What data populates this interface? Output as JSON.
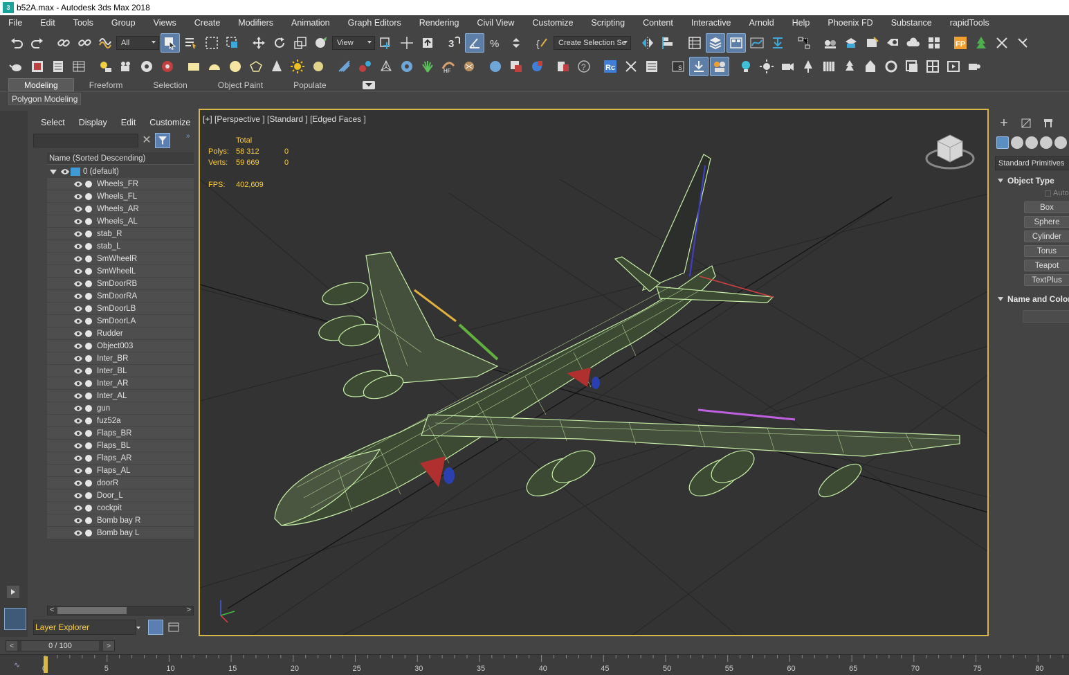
{
  "window": {
    "title": "b52A.max - Autodesk 3ds Max 2018"
  },
  "menu": [
    "File",
    "Edit",
    "Tools",
    "Group",
    "Views",
    "Create",
    "Modifiers",
    "Animation",
    "Graph Editors",
    "Rendering",
    "Civil View",
    "Customize",
    "Scripting",
    "Content",
    "Interactive",
    "Arnold",
    "Help",
    "Phoenix FD",
    "Substance",
    "rapidTools"
  ],
  "toolbar": {
    "filter_value": "All",
    "refcoord_value": "View",
    "selection_set_value": "Create Selection Se"
  },
  "ribbon": {
    "tabs": [
      "Modeling",
      "Freeform",
      "Selection",
      "Object Paint",
      "Populate"
    ],
    "active_tab": "Modeling",
    "sub_panel": "Polygon Modeling"
  },
  "explorer": {
    "menu": [
      "Select",
      "Display",
      "Edit",
      "Customize"
    ],
    "search_placeholder": "",
    "column_header": "Name (Sorted Descending)",
    "layer_name": "0 (default)",
    "objects": [
      "Wheels_FR",
      "Wheels_FL",
      "Wheels_AR",
      "Wheels_AL",
      "stab_R",
      "stab_L",
      "SmWheelR",
      "SmWheelL",
      "SmDoorRB",
      "SmDoorRA",
      "SmDoorLB",
      "SmDoorLA",
      "Rudder",
      "Object003",
      "Inter_BR",
      "Inter_BL",
      "Inter_AR",
      "Inter_AL",
      "gun",
      "fuz52a",
      "Flaps_BR",
      "Flaps_BL",
      "Flaps_AR",
      "Flaps_AL",
      "doorR",
      "Door_L",
      "cockpit",
      "Bomb bay R",
      "Bomb bay L"
    ],
    "footer_label": "Layer Explorer"
  },
  "viewport": {
    "label": "[+] [Perspective ] [Standard ] [Edged Faces ]",
    "stats": {
      "header": "Total",
      "polys_label": "Polys:",
      "polys_value": "58 312",
      "polys_sel": "0",
      "verts_label": "Verts:",
      "verts_value": "59 669",
      "verts_sel": "0",
      "fps_label": "FPS:",
      "fps_value": "402,609"
    },
    "border_color": "#d9b847",
    "wire_color": "#c8f0a8"
  },
  "command_panel": {
    "category": "Standard Primitives",
    "rollout_object_type": "Object Type",
    "autogrid_label": "AutoG",
    "primitives": [
      "Box",
      "Sphere",
      "Cylinder",
      "Torus",
      "Teapot",
      "TextPlus"
    ],
    "rollout_name_color": "Name and Color"
  },
  "timeline": {
    "frame_label": "0 / 100",
    "ticks": [
      "0",
      "5",
      "10",
      "15",
      "20",
      "25",
      "30",
      "35",
      "40",
      "45",
      "50",
      "55",
      "60",
      "65",
      "70",
      "75",
      "80"
    ]
  }
}
